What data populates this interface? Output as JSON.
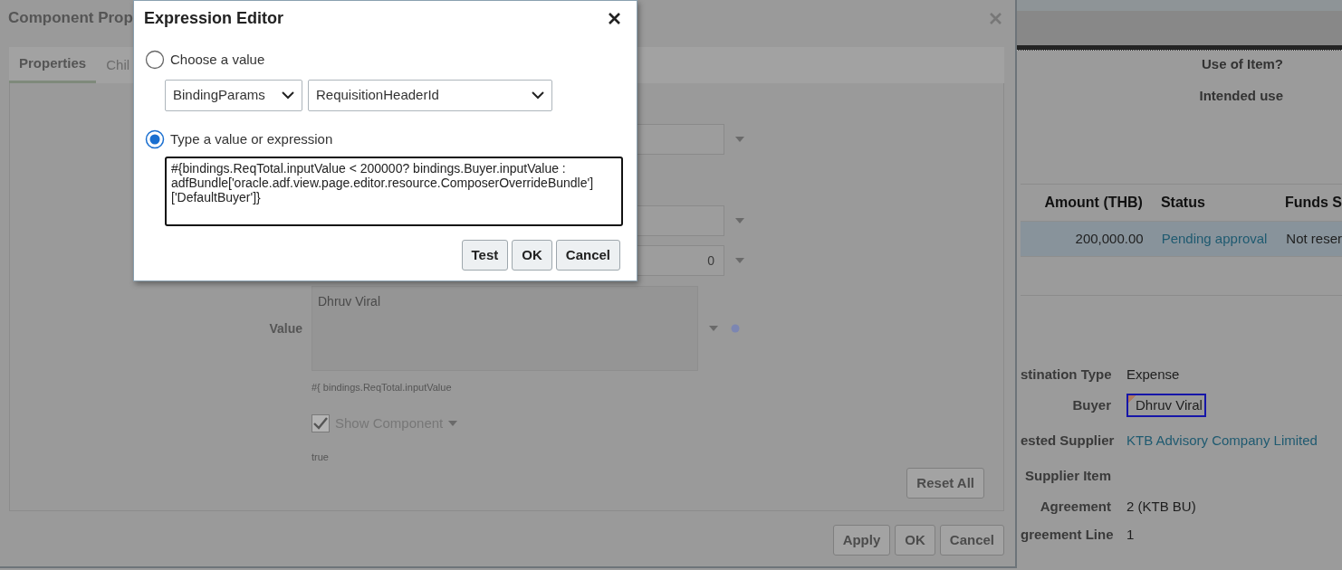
{
  "background_page": {
    "labels": [
      "Use of Item?",
      "Intended use"
    ],
    "table": {
      "columns": [
        "Amount (THB)",
        "Status",
        "Funds S"
      ],
      "rows": [
        {
          "selected": true,
          "cells": [
            {
              "text": "200,000.00",
              "kind": "number"
            },
            {
              "text": "Pending approval",
              "kind": "link"
            },
            {
              "text": "Not reser",
              "kind": "text"
            }
          ]
        }
      ]
    },
    "details": [
      {
        "label": "stination Type",
        "value": "Expense",
        "kind": "text"
      },
      {
        "label": "Buyer",
        "value": "Dhruv Viral",
        "kind": "field"
      },
      {
        "label": "ested Supplier",
        "value": "KTB Advisory Company Limited",
        "kind": "link"
      },
      {
        "label": "Supplier Item",
        "kind": "text"
      },
      {
        "label": "Agreement",
        "value": "2 (KTB BU)",
        "kind": "text"
      },
      {
        "label": "greement Line",
        "value": "1",
        "kind": "text"
      }
    ]
  },
  "component_dialog": {
    "title": "Component Prop",
    "tabs": [
      {
        "label": "Properties",
        "selected": true
      },
      {
        "label": "Chil",
        "selected": false
      }
    ],
    "number_field": {
      "value": "0"
    },
    "value_field": {
      "label": "Value",
      "value": "Dhruv Viral",
      "disabled": true,
      "hint": "#{ bindings.ReqTotal.inputValue"
    },
    "show_component": {
      "label": "Show Component",
      "checked": true,
      "disabled": true,
      "hint": "true"
    },
    "reset_button": "Reset All",
    "buttons": [
      "Apply",
      "OK",
      "Cancel"
    ]
  },
  "expression_editor": {
    "title": "Expression Editor",
    "options": [
      {
        "label": "Choose a value",
        "selected": false
      },
      {
        "label": "Type a value or expression",
        "selected": true
      }
    ],
    "selects": [
      {
        "value": "BindingParams"
      },
      {
        "value": "RequisitionHeaderId"
      }
    ],
    "expression": "#{bindings.ReqTotal.inputValue < 200000? bindings.Buyer.inputValue : adfBundle['oracle.adf.view.page.editor.resource.ComposerOverrideBundle']['DefaultBuyer']}",
    "buttons": [
      "Test",
      "OK",
      "Cancel"
    ]
  }
}
